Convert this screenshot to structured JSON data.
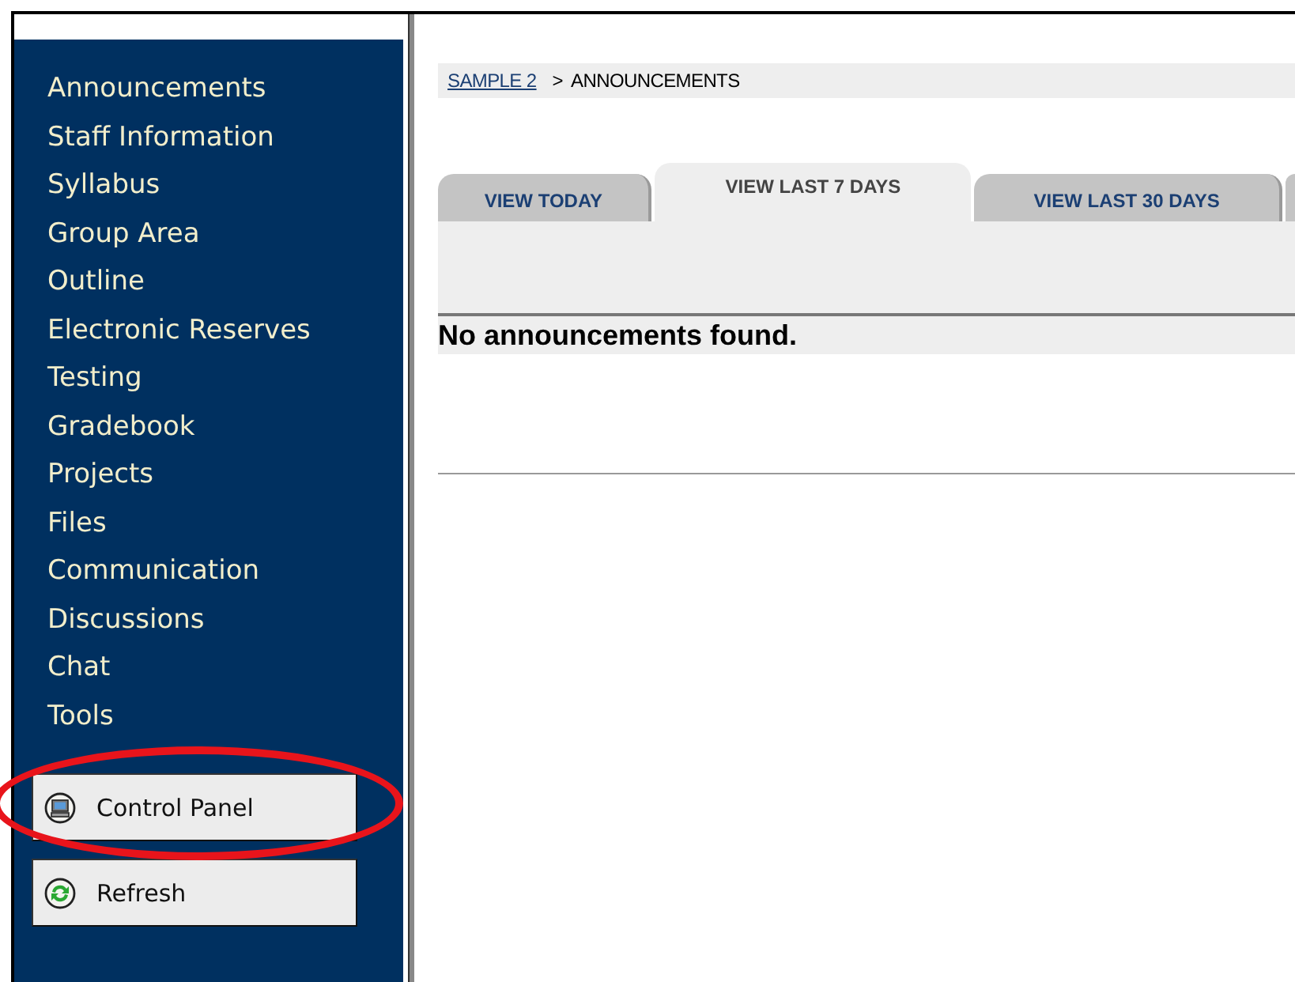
{
  "sidebar": {
    "items": [
      {
        "label": "Announcements"
      },
      {
        "label": "Staff Information"
      },
      {
        "label": "Syllabus"
      },
      {
        "label": "Group Area"
      },
      {
        "label": "Outline"
      },
      {
        "label": "Electronic Reserves"
      },
      {
        "label": "Testing"
      },
      {
        "label": "Gradebook"
      },
      {
        "label": "Projects"
      },
      {
        "label": "Files"
      },
      {
        "label": "Communication"
      },
      {
        "label": "Discussions"
      },
      {
        "label": "Chat"
      },
      {
        "label": "Tools"
      }
    ],
    "buttons": [
      {
        "label": "Control Panel",
        "kind": "computer"
      },
      {
        "label": "Refresh",
        "kind": "refresh"
      }
    ]
  },
  "breadcrumb": {
    "link": "SAMPLE 2",
    "separator": ">",
    "current": "ANNOUNCEMENTS"
  },
  "tabs": [
    {
      "label": "VIEW TODAY",
      "selected": false
    },
    {
      "label": "VIEW LAST 7 DAYS",
      "selected": true
    },
    {
      "label": "VIEW LAST 30 DAYS",
      "selected": false
    }
  ],
  "message": "No announcements found.",
  "annotations": [
    {
      "kind": "ellipse",
      "color": "#e8141b"
    }
  ]
}
